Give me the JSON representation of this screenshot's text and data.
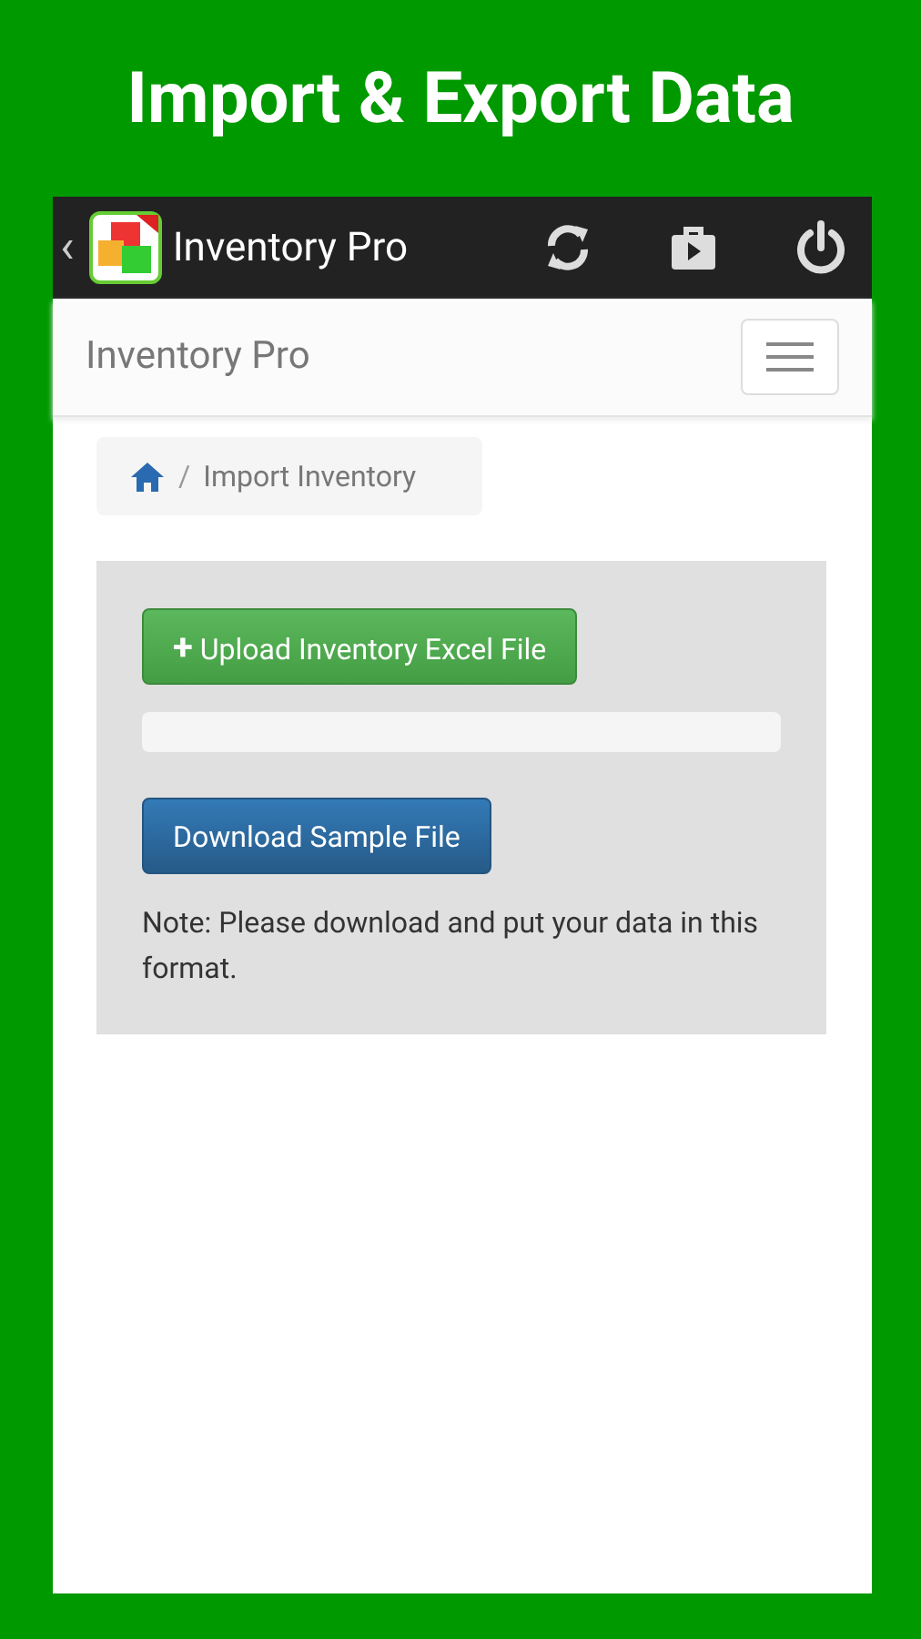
{
  "headline": "Import & Export Data",
  "action_bar": {
    "back": "‹",
    "title": "Inventory Pro"
  },
  "navbar": {
    "brand": "Inventory Pro"
  },
  "breadcrumb": {
    "separator": "/",
    "items": [
      "Import Inventory"
    ]
  },
  "panel": {
    "upload_button": {
      "icon": "+",
      "label": "Upload Inventory Excel File"
    },
    "progress": {
      "level": 0
    },
    "download_button": "Download Sample File",
    "note": "Note: Please download and put your data in this format."
  }
}
